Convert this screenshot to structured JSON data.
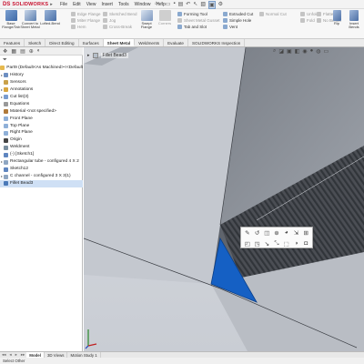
{
  "app": {
    "vendor_mark": "DS",
    "name": "SOLIDWORKS"
  },
  "menus": [
    "File",
    "Edit",
    "View",
    "Insert",
    "Tools",
    "Window",
    "Help"
  ],
  "ribbon": {
    "big_left": [
      {
        "label": "Base Flange/Tab",
        "icon": "base-flange-icon"
      },
      {
        "label": "Convert to Sheet Metal",
        "icon": "convert-icon"
      },
      {
        "label": "Lofted-Bend",
        "icon": "lofted-bend-icon"
      }
    ],
    "group_disabled_1": [
      "Edge Flange",
      "Miter Flange",
      "Hem"
    ],
    "group_disabled_2": [
      "Sketched Bend",
      "Jog",
      "Cross-Break"
    ],
    "swept": {
      "label": "Swept Flange"
    },
    "corners": {
      "label": "Corners"
    },
    "group_forming": [
      "Forming Tool",
      "Sheet Metal Gusset",
      "Tab and Slot"
    ],
    "group_extrude": [
      "Extruded Cut",
      "Simple Hole",
      "Vent"
    ],
    "group_cut": [
      "Normal Cut"
    ],
    "group_unfold": [
      "Unfold",
      "Fold"
    ],
    "group_flatten": [
      "Flatten",
      "No Bends"
    ],
    "rip": {
      "label": "Rip"
    },
    "insert_bends": {
      "label": "Insert Bends"
    }
  },
  "tabs": [
    "Features",
    "Sketch",
    "Direct Editing",
    "Surfaces",
    "Sheet Metal",
    "Weldments",
    "Evaluate",
    "SOLIDWORKS Inspection"
  ],
  "active_tab": "Sheet Metal",
  "tree": {
    "root": "Part9  (Default<As Machined><<Default",
    "items": [
      {
        "label": "History",
        "icon": "history-icon",
        "arrow": "▸"
      },
      {
        "label": "Sensors",
        "icon": "sensor-icon",
        "arrow": ""
      },
      {
        "label": "Annotations",
        "icon": "annotations-icon",
        "arrow": "▸"
      },
      {
        "label": "Cut list(3)",
        "icon": "cutlist-icon",
        "arrow": "▸"
      },
      {
        "label": "Equations",
        "icon": "equations-icon",
        "arrow": ""
      },
      {
        "label": "Material <not specified>",
        "icon": "material-icon",
        "arrow": ""
      },
      {
        "label": "Front Plane",
        "icon": "plane-icon",
        "arrow": ""
      },
      {
        "label": "Top Plane",
        "icon": "plane-icon",
        "arrow": ""
      },
      {
        "label": "Right Plane",
        "icon": "plane-icon",
        "arrow": ""
      },
      {
        "label": "Origin",
        "icon": "origin-icon",
        "arrow": ""
      },
      {
        "label": "Weldment",
        "icon": "weldment-icon",
        "arrow": ""
      },
      {
        "label": "(-) [Sketch1]",
        "icon": "sketch-icon",
        "arrow": ""
      },
      {
        "label": "Rectangular tube - configured 4 X 2",
        "icon": "structural-member-icon",
        "arrow": "▸"
      },
      {
        "label": "Sketch12",
        "icon": "sketch-icon",
        "arrow": ""
      },
      {
        "label": "C channel - configured 3 X 3(1)",
        "icon": "structural-member-icon",
        "arrow": "▸"
      },
      {
        "label": "Fillet Bead3",
        "icon": "fillet-bead-icon",
        "arrow": "",
        "selected": true
      }
    ]
  },
  "graphics": {
    "hud_label": "Fillet Bead3"
  },
  "bottom_tabs": [
    "Model",
    "3D Views",
    "Motion Study 1"
  ],
  "status": "Select Other",
  "colors": {
    "brand_red": "#c8102e",
    "selection_blue": "#1560c4",
    "bead_dark": "#3c3f45",
    "background": "#d3d6dc"
  }
}
